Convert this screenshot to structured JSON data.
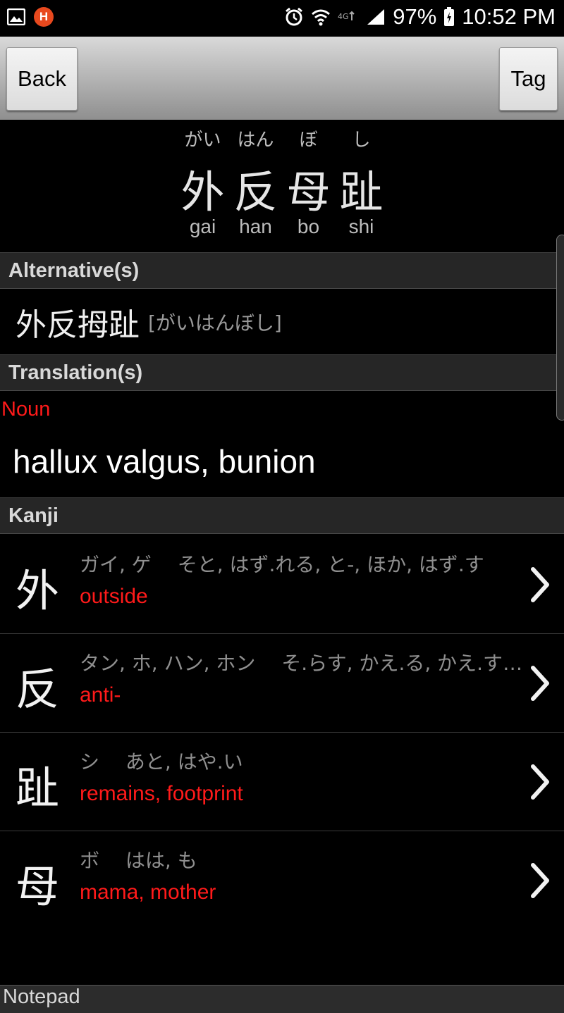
{
  "status_bar": {
    "battery": "97%",
    "time": "10:52 PM",
    "app_badge": "H"
  },
  "toolbar": {
    "back_label": "Back",
    "tag_label": "Tag"
  },
  "word": {
    "furigana": [
      "がい",
      "はん",
      "ぼ",
      "し"
    ],
    "kanji": [
      "外",
      "反",
      "母",
      "趾"
    ],
    "romaji": [
      "gai",
      "han",
      "bo",
      "shi"
    ]
  },
  "sections": {
    "alternatives_header": "Alternative(s)",
    "translations_header": "Translation(s)",
    "kanji_header": "Kanji",
    "notepad_header": "Notepad"
  },
  "alternative": {
    "kanji": "外反拇趾",
    "reading": "[がいはんぼし]"
  },
  "translation": {
    "part_of_speech": "Noun",
    "text": "hallux valgus, bunion"
  },
  "kanji_list": [
    {
      "char": "外",
      "readings": "ガイ, ゲ　 そと, はず.れる, と-, ほか, はず.す",
      "meaning": "outside"
    },
    {
      "char": "反",
      "readings": "タン, ホ, ハン, ホン　 そ.らす, かえ.る, かえ.す, そ.る",
      "meaning": "anti-"
    },
    {
      "char": "趾",
      "readings": "シ　 あと, はや.い",
      "meaning": "remains, footprint"
    },
    {
      "char": "母",
      "readings": "ボ　 はは, も",
      "meaning": "mama, mother"
    }
  ],
  "colors": {
    "accent_red": "#ff1a1a",
    "section_bg": "#262626"
  }
}
